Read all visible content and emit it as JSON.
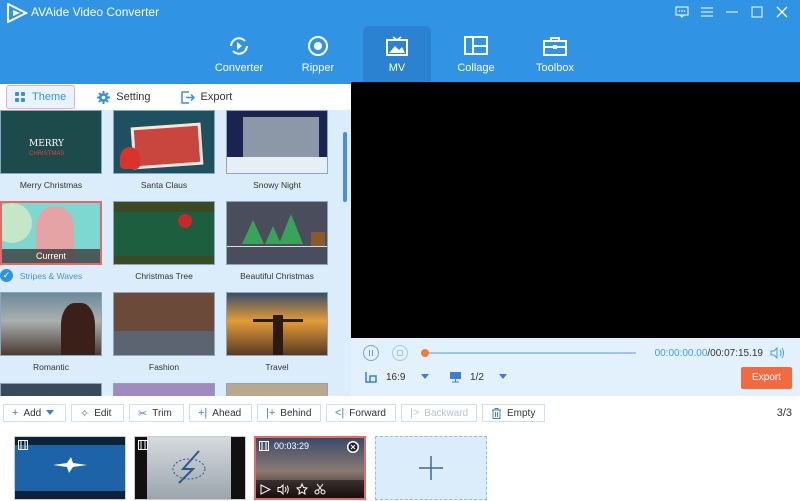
{
  "app": {
    "title": "AVAide Video Converter",
    "window_controls": [
      "feedback-icon",
      "menu-icon",
      "minimize-icon",
      "maximize-icon",
      "close-icon"
    ]
  },
  "nav": {
    "items": [
      {
        "label": "Converter",
        "icon": "converter-icon",
        "active": false
      },
      {
        "label": "Ripper",
        "icon": "ripper-icon",
        "active": false
      },
      {
        "label": "MV",
        "icon": "mv-icon",
        "active": true
      },
      {
        "label": "Collage",
        "icon": "collage-icon",
        "active": false
      },
      {
        "label": "Toolbox",
        "icon": "toolbox-icon",
        "active": false
      }
    ]
  },
  "tabs": [
    {
      "label": "Theme",
      "icon": "grid-icon",
      "active": true
    },
    {
      "label": "Setting",
      "icon": "gear-icon",
      "active": false
    },
    {
      "label": "Export",
      "icon": "export-icon",
      "active": false
    }
  ],
  "themes": [
    {
      "label": "Merry Christmas"
    },
    {
      "label": "Santa Claus"
    },
    {
      "label": "Snowy Night"
    },
    {
      "label": "Stripes & Waves",
      "current": true,
      "badge": "Current"
    },
    {
      "label": "Christmas Tree"
    },
    {
      "label": "Beautiful Christmas"
    },
    {
      "label": "Romantic"
    },
    {
      "label": "Fashion"
    },
    {
      "label": "Travel"
    }
  ],
  "player": {
    "current_time": "00:00:00.00",
    "total_time": "/00:07:15.19",
    "progress": 0,
    "aspect_ratio": "16:9",
    "zoom": "1/2",
    "export_label": "Export"
  },
  "toolbar": {
    "add": "Add",
    "edit": "Edit",
    "trim": "Trim",
    "ahead": "Ahead",
    "behind": "Behind",
    "forward": "Forward",
    "backward": "Backward",
    "empty": "Empty",
    "counter": "3/3"
  },
  "clips": [
    {
      "duration": ""
    },
    {
      "duration": ""
    },
    {
      "duration": "00:03:29",
      "active": true
    }
  ],
  "colors": {
    "brand": "#3193e4",
    "accent": "#f26a3f"
  }
}
